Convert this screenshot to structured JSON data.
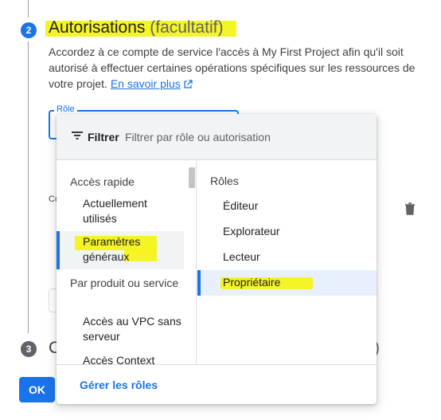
{
  "step2": {
    "number": "2",
    "title": "Autorisations",
    "optional": "(facultatif)",
    "description": "Accordez à ce compte de service l'accès à My First Project afin qu'il soit autorisé à effectuer certaines opérations spécifiques sur les ressources de votre projet.",
    "learn_more": "En savoir plus",
    "learn_more_icon": "external-link-icon",
    "role_label": "Rôle",
    "condition_label_fragment": "Co"
  },
  "step3": {
    "number": "3",
    "title_fragment": "C",
    "title_end_fragment": ")"
  },
  "ok_button": "OK",
  "dropdown": {
    "filter_label": "Filtrer",
    "filter_placeholder": "Filtrer par rôle ou autorisation",
    "left": {
      "quick_access_head": "Accès rapide",
      "currently_used": "Actuellement utilisés",
      "general_settings": "Paramètres généraux",
      "by_product_head": "Par produit ou service",
      "vpc_access": "Accès au VPC sans serveur",
      "clipped_item": "Accès Context"
    },
    "right": {
      "roles_head": "Rôles",
      "items": [
        "Éditeur",
        "Explorateur",
        "Lecteur",
        "Propriétaire"
      ],
      "selected": "Propriétaire"
    },
    "manage_roles": "Gérer les rôles"
  },
  "colors": {
    "accent": "#1a73e8",
    "highlight": "#f4f31a",
    "selected_bg": "#e8f0fe"
  }
}
